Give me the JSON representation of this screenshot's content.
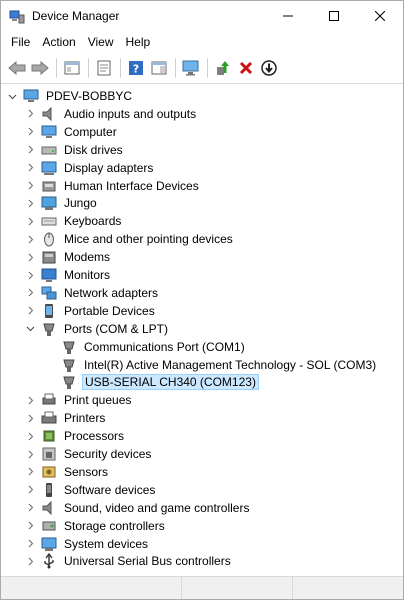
{
  "window": {
    "title": "Device Manager"
  },
  "menu": {
    "file": "File",
    "action": "Action",
    "view": "View",
    "help": "Help"
  },
  "tree": {
    "root": "PDEV-BOBBYC",
    "categories": [
      "Audio inputs and outputs",
      "Computer",
      "Disk drives",
      "Display adapters",
      "Human Interface Devices",
      "Jungo",
      "Keyboards",
      "Mice and other pointing devices",
      "Modems",
      "Monitors",
      "Network adapters",
      "Portable Devices",
      "Ports (COM & LPT)",
      "Print queues",
      "Printers",
      "Processors",
      "Security devices",
      "Sensors",
      "Software devices",
      "Sound, video and game controllers",
      "Storage controllers",
      "System devices",
      "Universal Serial Bus controllers"
    ],
    "ports_children": [
      "Communications Port (COM1)",
      "Intel(R) Active Management Technology - SOL (COM3)",
      "USB-SERIAL CH340 (COM123)"
    ]
  },
  "colors": {
    "selection_bg": "#cce8ff",
    "selection_border": "#99d1ff",
    "remove_red": "#d01010"
  }
}
